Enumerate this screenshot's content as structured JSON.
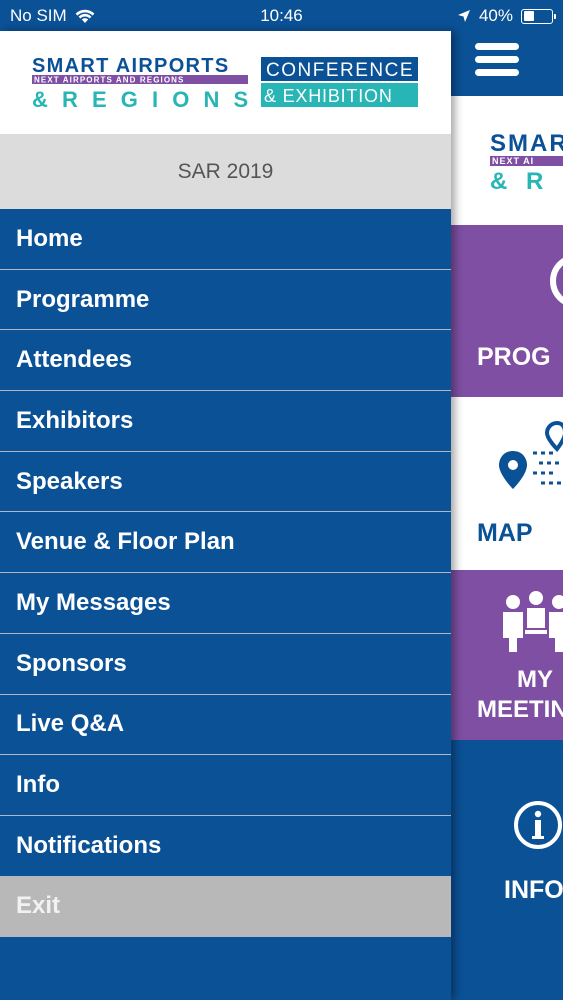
{
  "status_bar": {
    "carrier": "No SIM",
    "time": "10:46",
    "battery_percent": "40%",
    "battery_level": 0.4
  },
  "logo": {
    "line1": "SMART AIRPORTS",
    "line2": "NEXT AIRPORTS AND REGIONS",
    "line3": "& R E G I O N S",
    "box1": "CONFERENCE",
    "box2": "& EXHIBITION"
  },
  "event_name": "SAR 2019",
  "menu": [
    {
      "label": "Home"
    },
    {
      "label": "Programme"
    },
    {
      "label": "Attendees"
    },
    {
      "label": "Exhibitors"
    },
    {
      "label": "Speakers"
    },
    {
      "label": "Venue & Floor Plan"
    },
    {
      "label": "My Messages"
    },
    {
      "label": "Sponsors"
    },
    {
      "label": "Live Q&A"
    },
    {
      "label": "Info"
    },
    {
      "label": "Notifications"
    },
    {
      "label": "Exit"
    }
  ],
  "home": {
    "logo_line1": "SMAR",
    "logo_line2": "NEXT AI",
    "logo_line3": "& R",
    "tiles": [
      {
        "label": "PROG"
      },
      {
        "label": "MAP"
      },
      {
        "label_line1": "MY",
        "label_line2": "MEETIN"
      },
      {
        "label": "INFO"
      }
    ]
  },
  "colors": {
    "primary_blue": "#0b5196",
    "purple": "#7e4fa3",
    "teal": "#27b5b5",
    "exit_gray": "#b8b8b8"
  }
}
